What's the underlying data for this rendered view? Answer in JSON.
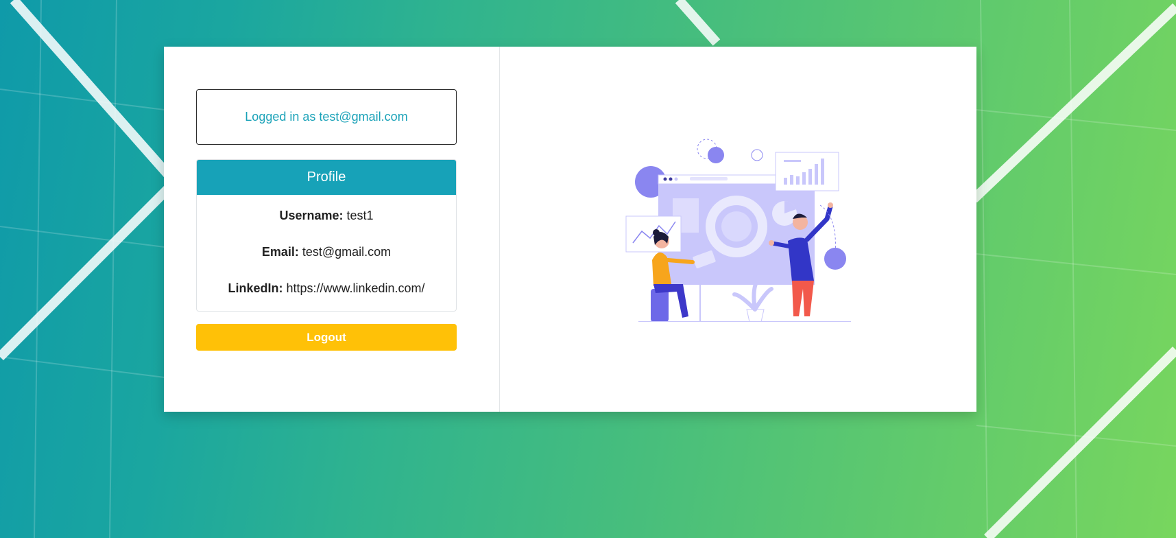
{
  "status": {
    "logged_in_text": "Logged in as test@gmail.com"
  },
  "profile": {
    "header": "Profile",
    "username_label": "Username:",
    "username_value": "test1",
    "email_label": "Email:",
    "email_value": "test@gmail.com",
    "linkedin_label": "LinkedIn:",
    "linkedin_value": "https://www.linkedin.com/"
  },
  "actions": {
    "logout_label": "Logout"
  },
  "colors": {
    "accent": "#17a2b8",
    "logout": "#ffc107",
    "illustration_primary": "#8a86f0",
    "illustration_light": "#c9c7fb"
  },
  "illustration": {
    "icon": "analytics-team-illustration"
  }
}
